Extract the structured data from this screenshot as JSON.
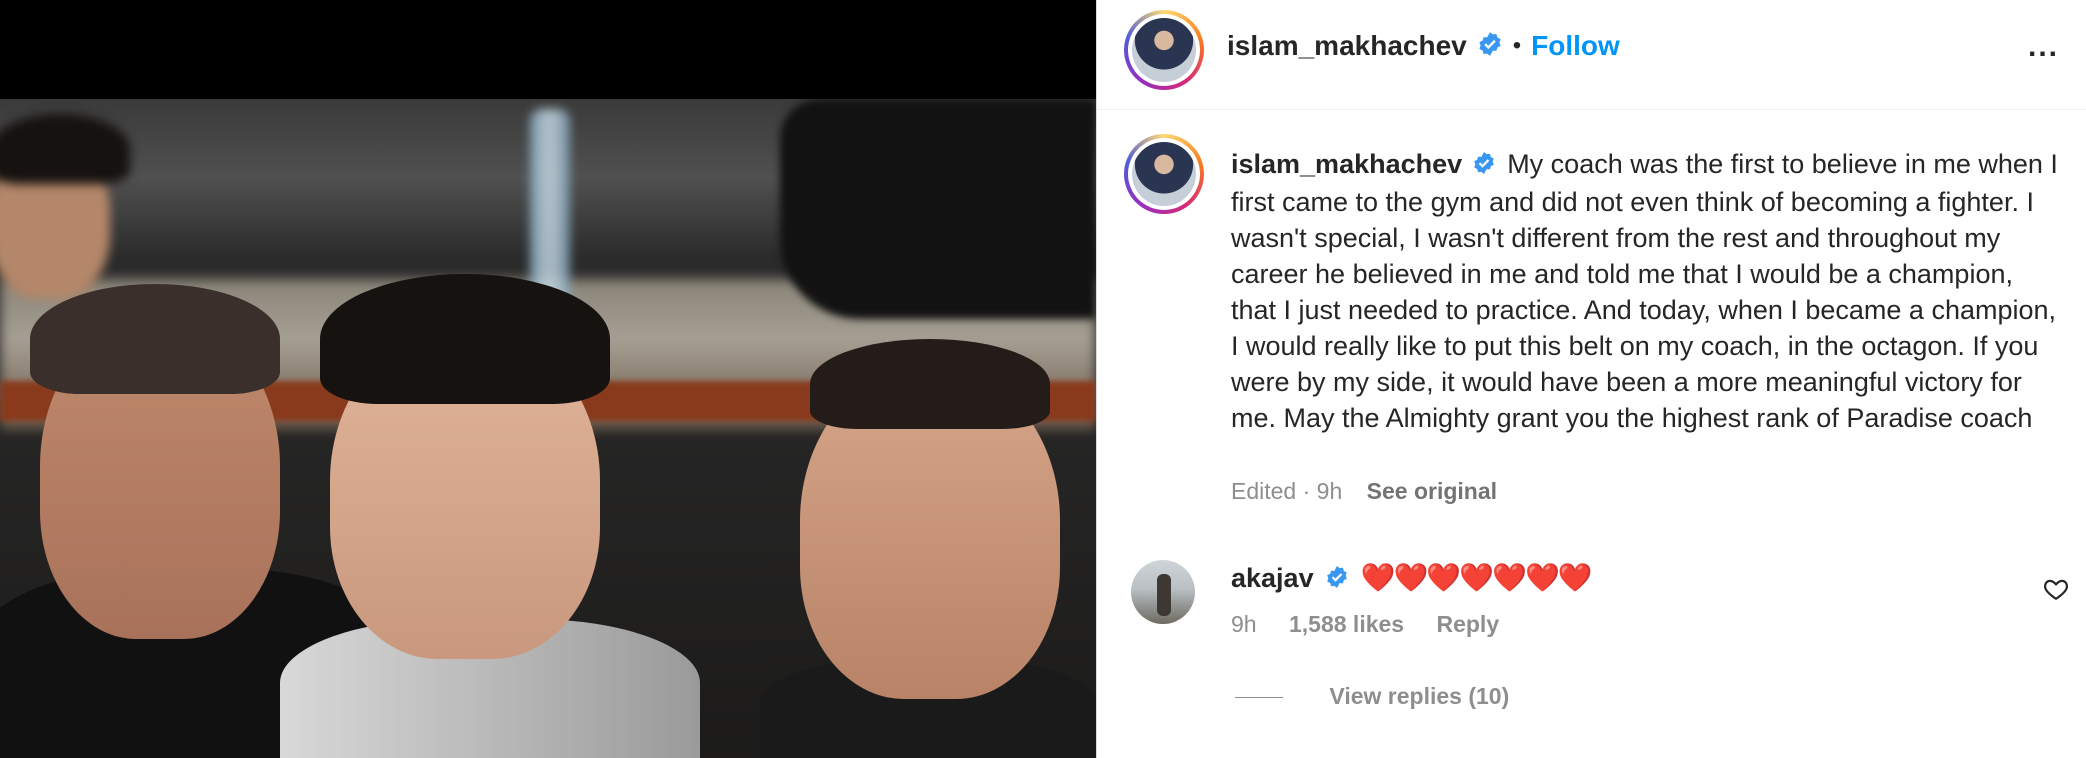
{
  "post": {
    "author": "islam_makhachev",
    "follow_label": "Follow",
    "separator": "•",
    "more_label": "..."
  },
  "caption": {
    "author": "islam_makhachev",
    "text": "My coach was the first to believe in me when I first came to the gym and did not even think of becoming a fighter. I wasn't special, I wasn't different from the rest and throughout my career he believed in me and told me that I would be a champion, that I just needed to practice. And today, when I became a champion, I would really like to put this belt on my coach, in the octagon. If you were by my side, it would have been a more meaningful victory for me. May the Almighty grant you the highest rank of Paradise coach",
    "edited_label": "Edited · 9h",
    "see_original_label": "See original"
  },
  "comment": {
    "author": "akajav",
    "text": "❤️❤️❤️❤️❤️❤️❤️",
    "time": "9h",
    "likes": "1,588 likes",
    "reply_label": "Reply",
    "view_replies_label": "View replies (10)"
  },
  "colors": {
    "link_blue": "#0095f6",
    "verified_blue": "#3897f0",
    "muted_text": "#8e8e8e",
    "heart_red": "#ed1c24"
  },
  "icons": {
    "verified": "verified-badge-icon",
    "more": "more-options-icon",
    "like": "heart-outline-icon"
  }
}
